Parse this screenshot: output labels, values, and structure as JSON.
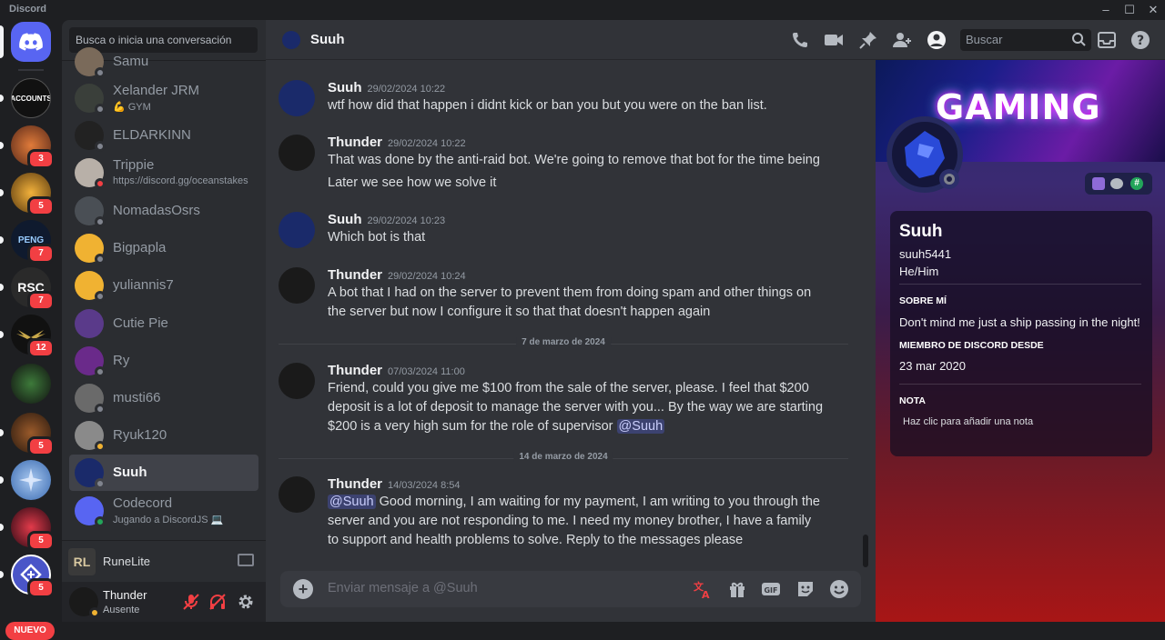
{
  "app": {
    "title": "Discord"
  },
  "window_controls": {
    "minimize": "–",
    "maximize": "☐",
    "close": "✕"
  },
  "guilds": {
    "items": [
      {
        "name": "discord-home",
        "badge": ""
      },
      {
        "name": "accounts",
        "label": "ACCOUNTS",
        "badge": ""
      },
      {
        "name": "server-2",
        "badge": "3"
      },
      {
        "name": "server-3",
        "badge": "5"
      },
      {
        "name": "peng-services",
        "label": "PENG",
        "badge": "7"
      },
      {
        "name": "rsc",
        "label": "RSC",
        "badge": "7"
      },
      {
        "name": "victory",
        "badge": "12"
      },
      {
        "name": "server-7",
        "badge": ""
      },
      {
        "name": "server-8",
        "badge": "5"
      },
      {
        "name": "server-9",
        "badge": ""
      },
      {
        "name": "server-10",
        "badge": "5"
      },
      {
        "name": "server-11",
        "badge": "5"
      }
    ],
    "new_label": "NUEVO"
  },
  "dm_sidebar": {
    "search_placeholder": "Busca o inicia una conversación",
    "dms": [
      {
        "name": "Samu",
        "sub": ""
      },
      {
        "name": "Xelander JRM",
        "sub": "💪 GYM"
      },
      {
        "name": "ELDARKINN",
        "sub": ""
      },
      {
        "name": "Trippie",
        "sub": "https://discord.gg/oceanstakes"
      },
      {
        "name": "NomadasOsrs",
        "sub": ""
      },
      {
        "name": "Bigpapla",
        "sub": ""
      },
      {
        "name": "yuliannis7",
        "sub": ""
      },
      {
        "name": "Cutie Pie",
        "sub": ""
      },
      {
        "name": "Ry",
        "sub": ""
      },
      {
        "name": "musti66",
        "sub": ""
      },
      {
        "name": "Ryuk120",
        "sub": ""
      },
      {
        "name": "Suuh",
        "sub": ""
      },
      {
        "name": "Codecord",
        "sub": "Jugando a DiscordJS 💻"
      }
    ],
    "activity": {
      "name": "RuneLite"
    },
    "user": {
      "name": "Thunder",
      "status": "Ausente"
    }
  },
  "chat": {
    "channel_name": "Suuh",
    "search_placeholder": "Buscar",
    "composer_placeholder": "Enviar mensaje a @Suuh",
    "messages": [
      {
        "author": "Suuh",
        "time": "29/02/2024 10:22",
        "lines": [
          "wtf how did that happen i didnt kick or ban you but you were on the ban list."
        ]
      },
      {
        "author": "Thunder",
        "time": "29/02/2024 10:22",
        "lines": [
          "That was done by the anti-raid bot. We're going to remove that bot for the time being",
          "Later we see how we solve it"
        ]
      },
      {
        "author": "Suuh",
        "time": "29/02/2024 10:23",
        "lines": [
          "Which bot is that"
        ]
      },
      {
        "author": "Thunder",
        "time": "29/02/2024 10:24",
        "lines": [
          "A bot that I had on the server to prevent them from doing spam and other things on the server but now I configure it so that that doesn't happen again"
        ]
      },
      {
        "author": "Thunder",
        "time": "07/03/2024 11:00",
        "lines": [
          "Friend, could you give me $100 from the sale of the server, please. I feel that $200 deposit is a lot of deposit to manage the server with you... By the way we are starting $200 is a very high sum for the role of supervisor"
        ],
        "mention": "@Suuh"
      },
      {
        "author": "Thunder",
        "time": "14/03/2024 8:54",
        "mention": "@Suuh",
        "lines": [
          "Good morning, I am waiting for my payment, I am writing to you through the server and you are not responding to me. I need my money brother, I have a family to support and health problems to solve. Reply to the messages please"
        ]
      }
    ],
    "date_dividers": [
      "7 de marzo de 2024",
      "14 de marzo de 2024"
    ]
  },
  "profile": {
    "banner_text": "GAMING",
    "display_name": "Suuh",
    "username": "suuh5441",
    "pronouns": "He/Him",
    "about_heading": "SOBRE MÍ",
    "about_text": "Don't mind me just a ship passing in the night!",
    "member_heading": "MIEMBRO DE DISCORD DESDE",
    "member_since": "23 mar 2020",
    "note_heading": "NOTA",
    "note_placeholder": "Haz clic para añadir una nota"
  },
  "colors": {
    "accent": "#5865f2",
    "danger": "#f23f43",
    "online": "#23a55a",
    "idle": "#f0b232",
    "offline": "#80848e"
  }
}
